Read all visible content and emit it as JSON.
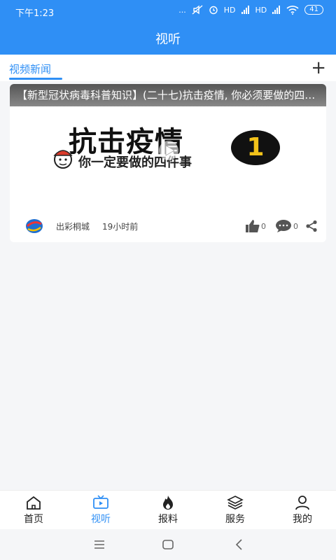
{
  "status": {
    "time": "下午1:23",
    "dots": "...",
    "signal1": "HD",
    "signal2": "HD",
    "battery": "41"
  },
  "header": {
    "title": "视听"
  },
  "tabs": {
    "active_label": "视频新闻",
    "add_icon": "plus-icon"
  },
  "video_card": {
    "title": "【新型冠状病毒科普知识】(二十七)抗击疫情, 你必须要做的四件事",
    "poster_main_text": "抗击疫情",
    "poster_sub_text": "你一定要做的四件事",
    "poster_badge": "1",
    "source": "出彩桐城",
    "time_ago": "19小时前",
    "likes": "0",
    "comments": "0"
  },
  "bottom_nav": {
    "items": [
      {
        "label": "首页",
        "icon": "home-icon"
      },
      {
        "label": "视听",
        "icon": "tv-icon"
      },
      {
        "label": "报料",
        "icon": "flame-icon"
      },
      {
        "label": "服务",
        "icon": "layers-icon"
      },
      {
        "label": "我的",
        "icon": "user-icon"
      }
    ],
    "active_index": 1
  },
  "colors": {
    "primary": "#2f8ff5",
    "badge": "#f2c21a"
  }
}
